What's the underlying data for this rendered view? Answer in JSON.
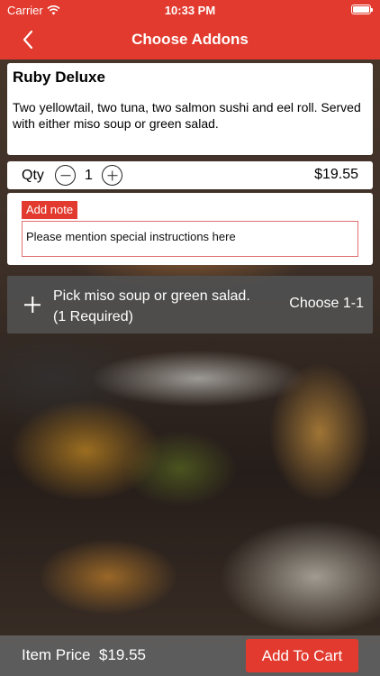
{
  "status_bar": {
    "carrier": "Carrier",
    "time": "10:33 PM"
  },
  "header": {
    "title": "Choose Addons"
  },
  "item": {
    "name": "Ruby Deluxe",
    "description": "Two yellowtail, two tuna, two salmon sushi and eel roll. Served with either miso soup or green salad."
  },
  "quantity": {
    "label": "Qty",
    "value": "1",
    "price": "$19.55"
  },
  "note": {
    "tag": "Add note",
    "placeholder": "Please mention special instructions here"
  },
  "addon_group": {
    "title": "Pick  miso soup or green salad.",
    "requirement": "(1 Required)",
    "choose_label": "Choose 1-1"
  },
  "footer": {
    "item_price_label": "Item Price",
    "item_price": "$19.55",
    "add_to_cart_label": "Add To Cart"
  },
  "colors": {
    "accent": "#e23a2e",
    "panel_dark": "#505050"
  }
}
